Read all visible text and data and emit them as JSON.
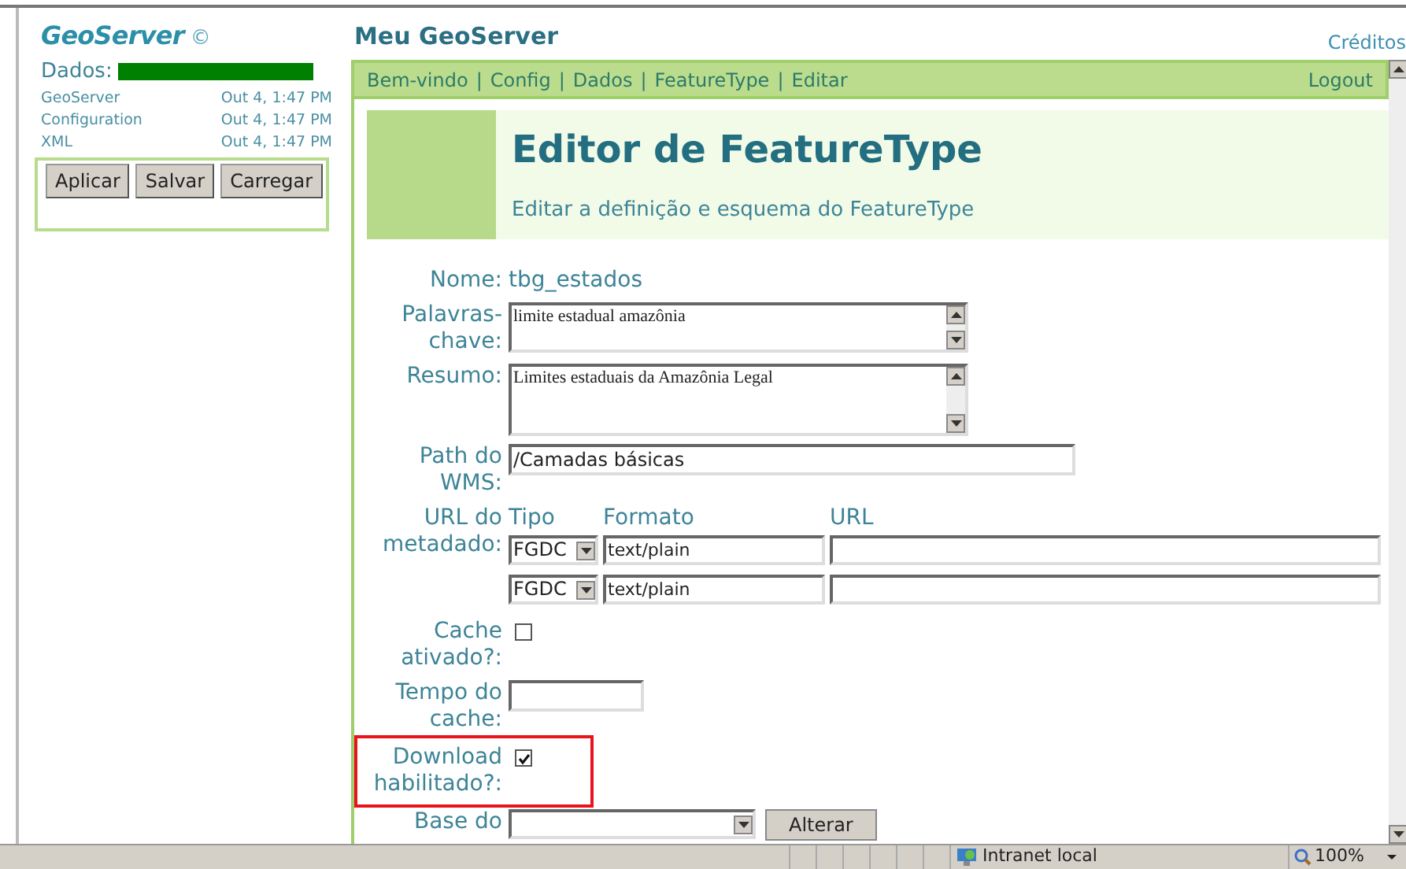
{
  "sidebar": {
    "logo": "GeoServer",
    "logo_mark": "©",
    "data_label": "Dados:",
    "level": 1,
    "items": [
      {
        "name": "GeoServer",
        "time": "Out 4, 1:47 PM"
      },
      {
        "name": "Configuration",
        "time": "Out 4, 1:47 PM"
      },
      {
        "name": "XML",
        "time": "Out 4, 1:47 PM"
      }
    ],
    "buttons": [
      "Aplicar",
      "Salvar",
      "Carregar"
    ]
  },
  "header": {
    "title": "Meu GeoServer",
    "link": "Créditos"
  },
  "breadcrumb": {
    "items": [
      "Bem-vindo",
      "Config",
      "Dados",
      "FeatureType",
      "Editar"
    ],
    "separator": "|",
    "logout": "Logout"
  },
  "page": {
    "title": "Editor de FeatureType",
    "subtitle": "Editar a definição e esquema do FeatureType"
  },
  "form": [
    {
      "kind": "text",
      "label": "Nome:",
      "value": "tbg_estados"
    },
    {
      "kind": "textarea",
      "label": "Palavras-chave:",
      "value": "limite estadual amazônia"
    },
    {
      "kind": "textarea",
      "label": "Resumo:",
      "value": "Limites estaduais da Amazônia Legal"
    },
    {
      "kind": "input",
      "label": "Path do WMS:",
      "value": "/Camadas básicas"
    },
    {
      "kind": "metadata",
      "label": "URL do metadado:",
      "columns": [
        "Tipo",
        "Formato",
        "URL"
      ],
      "rows": [
        {
          "type": "FGDC",
          "format": "text/plain"
        },
        {
          "type": "FGDC",
          "format": "text/plain"
        }
      ]
    },
    {
      "kind": "checkbox",
      "label": "Cache ativado?:",
      "checked": false,
      "highlighted": false
    },
    {
      "kind": "input",
      "label": "Tempo do cache:"
    },
    {
      "kind": "checkbox",
      "label": "Download habilitado?:",
      "checked": true,
      "highlighted": true
    },
    {
      "kind": "select-button",
      "label": "Base do",
      "button": "Alterar"
    }
  ],
  "status_bar": {
    "zone": "Intranet local",
    "zoom": "100%"
  }
}
